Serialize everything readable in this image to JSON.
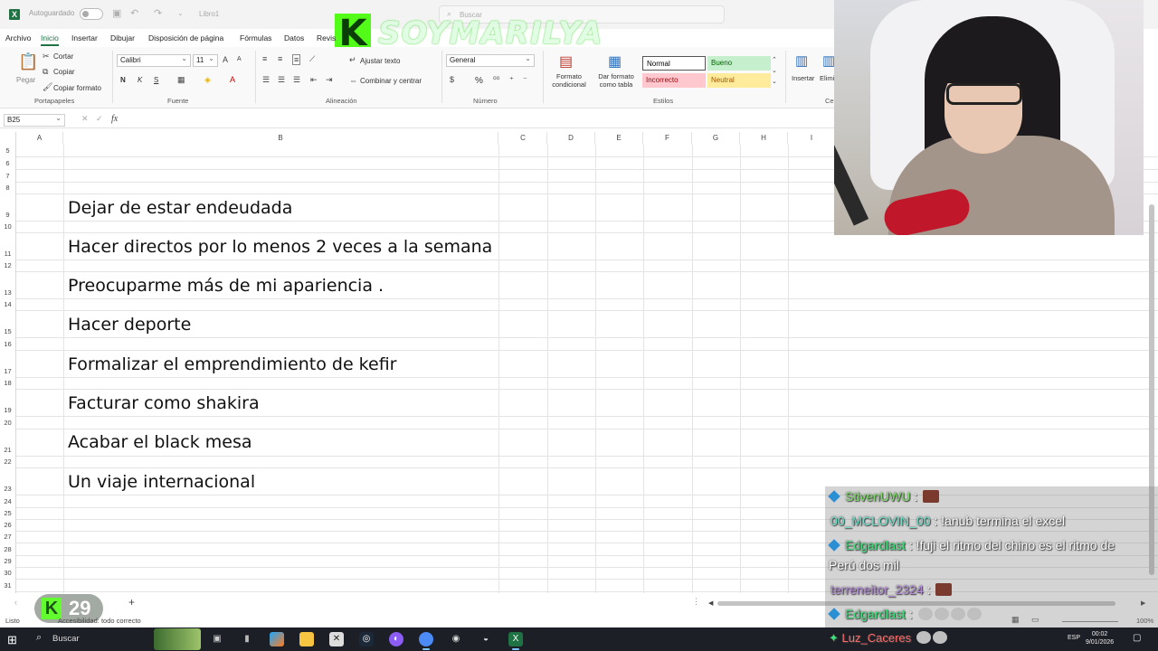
{
  "titlebar": {
    "autosave_label": "Autoguardado",
    "doc_title": "Libro1",
    "search_placeholder": "Buscar"
  },
  "overlay": {
    "brand_letter": "K",
    "streamer_name": "SOYMARILYA",
    "viewer_count": "29"
  },
  "menu": {
    "tabs": [
      "Archivo",
      "Inicio",
      "Insertar",
      "Dibujar",
      "Disposición de página",
      "Fórmulas",
      "Datos",
      "Revis"
    ],
    "active": "Inicio"
  },
  "ribbon": {
    "clipboard": {
      "paste": "Pegar",
      "cut": "Cortar",
      "copy": "Copiar",
      "format_painter": "Copiar formato",
      "label": "Portapapeles"
    },
    "font": {
      "name": "Calibri",
      "size": "11",
      "label": "Fuente",
      "bold": "N",
      "italic": "K",
      "underline": "S"
    },
    "alignment": {
      "wrap": "Ajustar texto",
      "merge": "Combinar y centrar",
      "label": "Alineación"
    },
    "number": {
      "format": "General",
      "label": "Número",
      "percent": "%"
    },
    "styles": {
      "cond_format": "Formato condicional",
      "table_format": "Dar formato como tabla",
      "normal": "Normal",
      "good": "Bueno",
      "bad": "Incorrecto",
      "neutral": "Neutral",
      "label": "Estilos"
    },
    "cells": {
      "insert": "Insertar",
      "delete": "Elimi",
      "label": "Ce"
    }
  },
  "formula_bar": {
    "name_box": "B25",
    "fx": "fx"
  },
  "columns": [
    "A",
    "B",
    "C",
    "D",
    "E",
    "F",
    "G",
    "H",
    "I"
  ],
  "rows": [
    "5",
    "6",
    "7",
    "8",
    "9",
    "10",
    "11",
    "12",
    "13",
    "14",
    "15",
    "16",
    "17",
    "18",
    "19",
    "20",
    "21",
    "22",
    "23",
    "24",
    "25",
    "26",
    "27",
    "28",
    "29",
    "30",
    "31"
  ],
  "goals": [
    "Dejar de estar endeudada",
    "Hacer directos por lo menos  2 veces a la semana",
    "Preocuparme más de mi apariencia .",
    "Hacer deporte",
    "Formalizar el emprendimiento de kefir",
    "Facturar como shakira",
    "Acabar el black mesa",
    "Un viaje internacional"
  ],
  "status": {
    "ready": "Listo",
    "accessibility": "Accesibilidad: todo correcto",
    "zoom": "100%"
  },
  "taskbar": {
    "search": "Buscar",
    "lang": "ESP",
    "time": "00:02",
    "date": "9/01/2026"
  },
  "chat": [
    {
      "user": "StivenUWU",
      "color": "#7fdc6a",
      "text": ""
    },
    {
      "user": "00_MCLOVIN_00",
      "color": "#6fe0c8",
      "text": "!anub termina el excel"
    },
    {
      "user": "Edgardlast",
      "color": "#3fe07a",
      "text": "!fuji el ritmo del chino es el ritmo de"
    },
    {
      "user": "",
      "color": "#ffffff",
      "text": "Perú dos mil"
    },
    {
      "user": "terreneitor_2324",
      "color": "#b58ad9",
      "text": ""
    },
    {
      "user": "Edgardlast",
      "color": "#3fe07a",
      "text": ""
    },
    {
      "user": "Luz_Caceres",
      "color": "#ff6b6b",
      "text": ""
    }
  ]
}
